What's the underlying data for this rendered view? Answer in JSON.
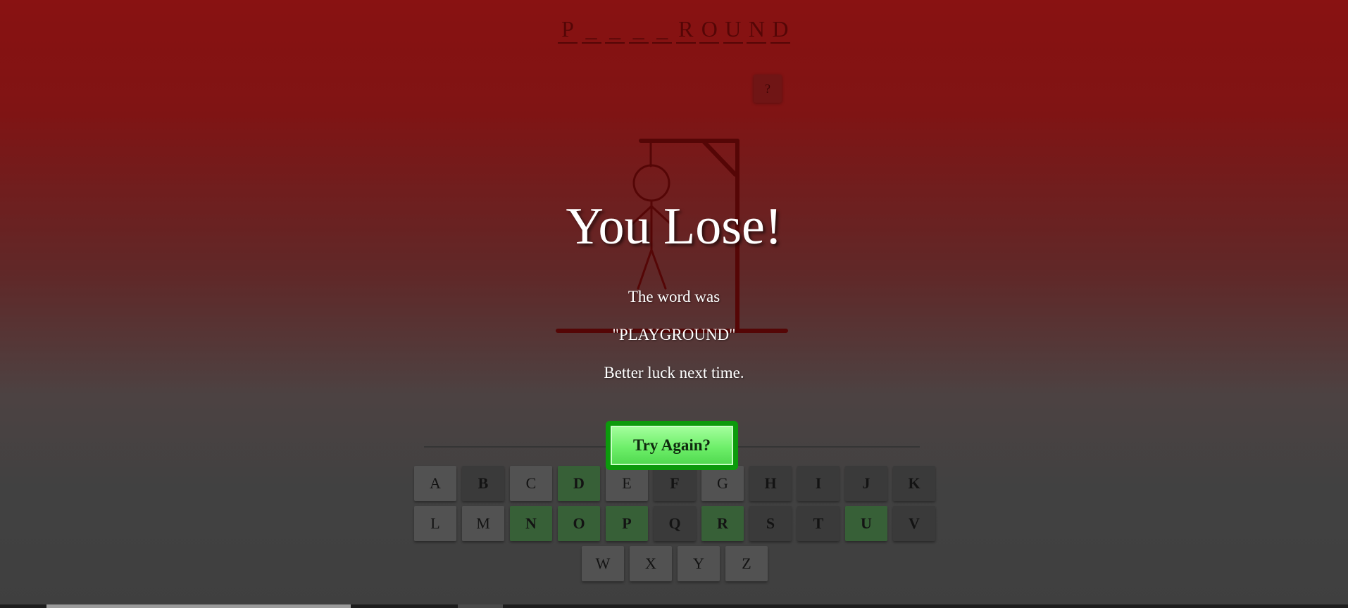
{
  "game": {
    "word_display": [
      "P",
      "_",
      "_",
      "_",
      "_",
      "R",
      "O",
      "U",
      "N",
      "D"
    ],
    "hint_label": "?",
    "result_title": "You Lose!",
    "message_line1": "The word was",
    "message_word": "\"PLAYGROUND\"",
    "message_line2": "Better luck next time.",
    "try_again_label": "Try Again?"
  },
  "keyboard": {
    "rows": [
      [
        {
          "letter": "A",
          "state": "unused"
        },
        {
          "letter": "B",
          "state": "wrong"
        },
        {
          "letter": "C",
          "state": "unused"
        },
        {
          "letter": "D",
          "state": "correct"
        },
        {
          "letter": "E",
          "state": "unused"
        },
        {
          "letter": "F",
          "state": "wrong"
        },
        {
          "letter": "G",
          "state": "unused"
        },
        {
          "letter": "H",
          "state": "wrong"
        },
        {
          "letter": "I",
          "state": "wrong"
        },
        {
          "letter": "J",
          "state": "wrong"
        },
        {
          "letter": "K",
          "state": "wrong"
        }
      ],
      [
        {
          "letter": "L",
          "state": "unused"
        },
        {
          "letter": "M",
          "state": "unused"
        },
        {
          "letter": "N",
          "state": "correct"
        },
        {
          "letter": "O",
          "state": "correct"
        },
        {
          "letter": "P",
          "state": "correct"
        },
        {
          "letter": "Q",
          "state": "wrong"
        },
        {
          "letter": "R",
          "state": "correct"
        },
        {
          "letter": "S",
          "state": "wrong"
        },
        {
          "letter": "T",
          "state": "wrong"
        },
        {
          "letter": "U",
          "state": "correct"
        },
        {
          "letter": "V",
          "state": "wrong"
        }
      ],
      [
        {
          "letter": "W",
          "state": "unused"
        },
        {
          "letter": "X",
          "state": "unused"
        },
        {
          "letter": "Y",
          "state": "unused"
        },
        {
          "letter": "Z",
          "state": "unused"
        }
      ]
    ]
  },
  "colors": {
    "correct": "#4f8a4f",
    "wrong": "#535353",
    "unused": "#767676",
    "try_again_border": "#0c9a0c"
  }
}
